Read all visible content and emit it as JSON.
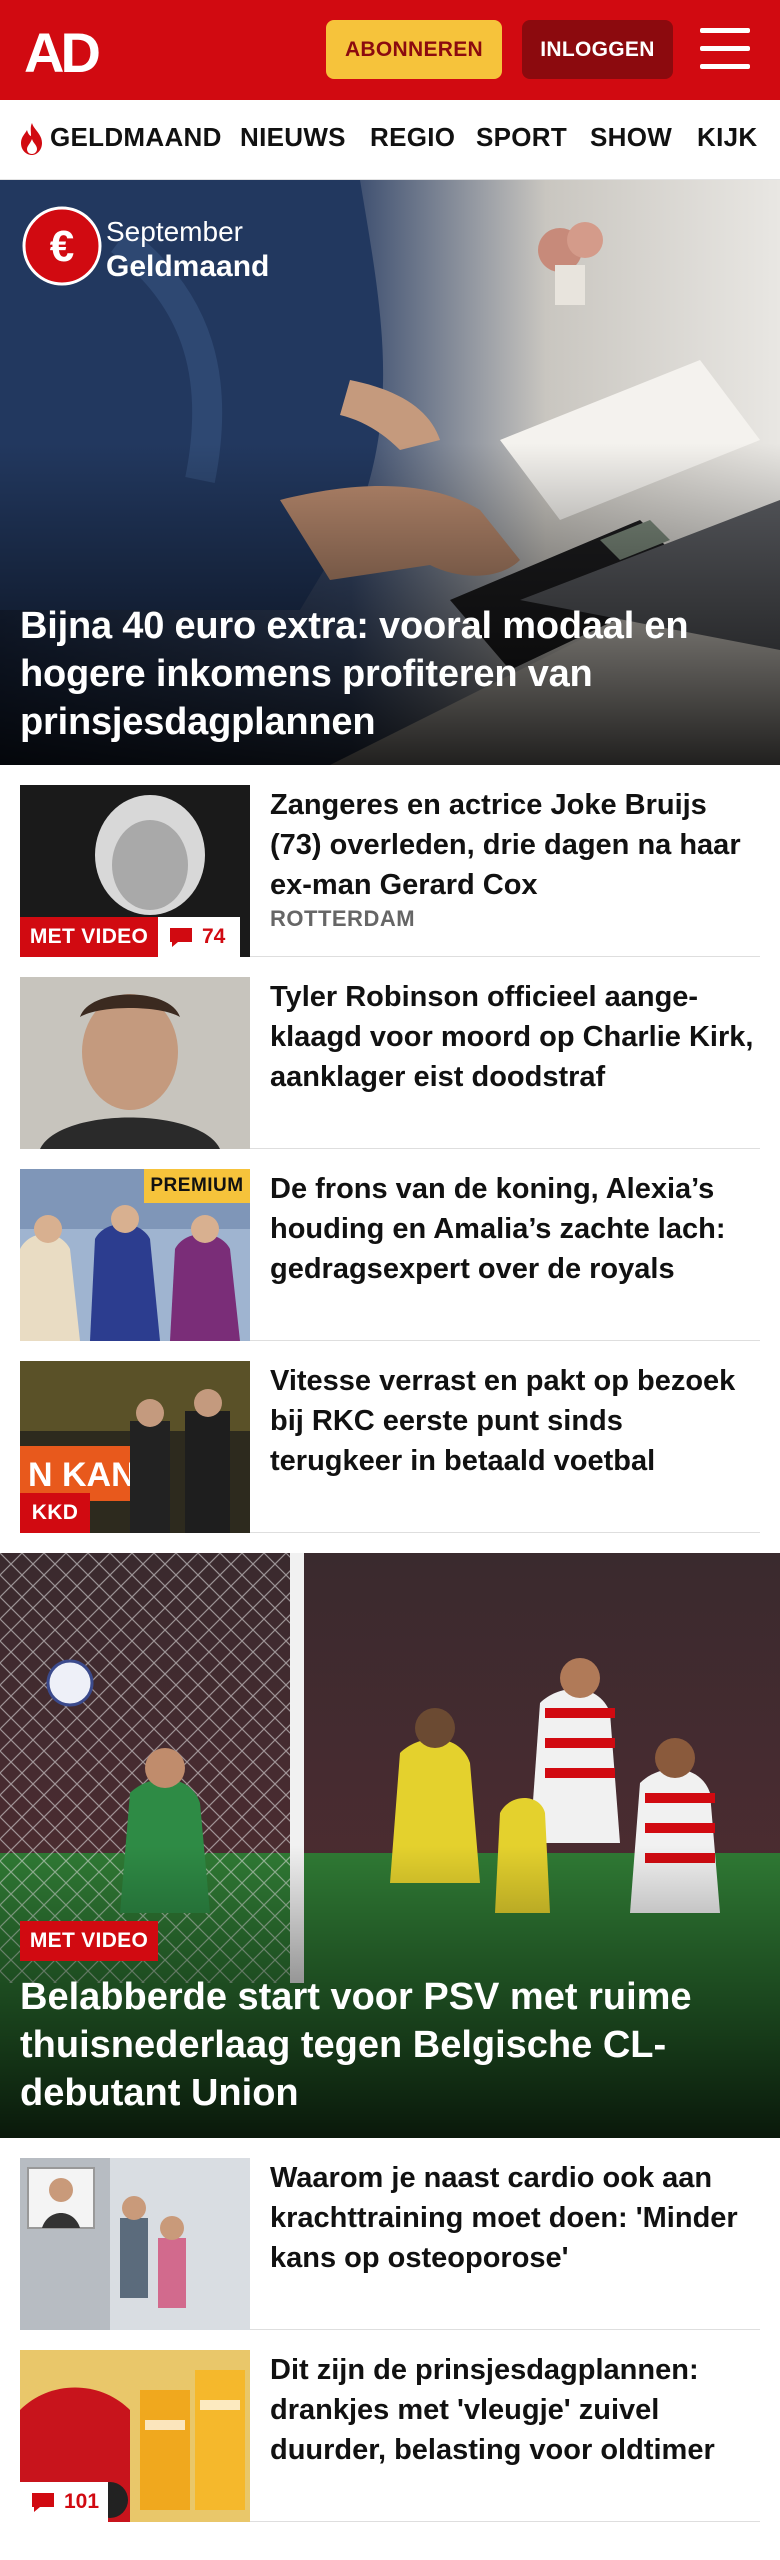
{
  "header": {
    "logo_text": "AD",
    "subscribe_label": "ABONNEREN",
    "login_label": "INLOGGEN",
    "menu_icon": "hamburger-menu-icon",
    "brand_color": "#d10a11"
  },
  "nav": {
    "items": [
      {
        "label": "GELDMAAND",
        "icon": "flame-icon"
      },
      {
        "label": "NIEUWS"
      },
      {
        "label": "REGIO"
      },
      {
        "label": "SPORT"
      },
      {
        "label": "SHOW"
      },
      {
        "label": "KIJK"
      }
    ]
  },
  "hero": {
    "promo_line1": "September",
    "promo_line2": "Geldmaand",
    "promo_icon": "euro-icon",
    "title": "Bijna 40 euro extra: vooral modaal en hogere inkomens profiteren van prinsjesdagplannen"
  },
  "articles": [
    {
      "title": "Zangeres en actrice Joke Bruijs (73) overleden, drie dagen na haar ex-man Gerard Cox",
      "place": "ROTTERDAM",
      "badge": "MET VIDEO",
      "comments": "74"
    },
    {
      "title": "Tyler Robinson officieel aange-klaagd voor moord op Charlie Kirk, aanklager eist doodstraf"
    },
    {
      "title": "De frons van de koning, Alexia’s houding en Amalia’s zachte lach: gedragsexpert over de royals",
      "badge": "PREMIUM"
    },
    {
      "title": "Vitesse verrast en pakt op bezoek bij RKC eerste punt sinds terugkeer in betaald voetbal",
      "badge": "KKD"
    }
  ],
  "feature": {
    "badge": "MET VIDEO",
    "title": "Belabberde start voor PSV met ruime thuisnederlaag tegen Belgische CL-debutant Union"
  },
  "articles2": [
    {
      "title": "Waarom je naast cardio ook aan krachttraining moet doen: 'Minder kans op osteoporose'"
    },
    {
      "title": "Dit zijn de prinsjesdagplannen: drankjes met 'vleugje' zuivel duurder, belasting voor oldtimer",
      "comments": "101"
    }
  ]
}
